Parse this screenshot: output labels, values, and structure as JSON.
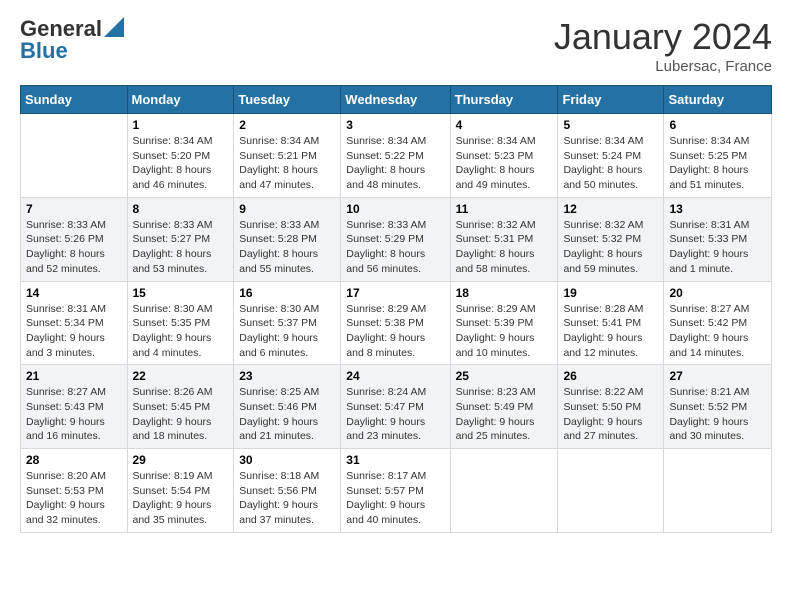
{
  "logo": {
    "general": "General",
    "blue": "Blue"
  },
  "title": "January 2024",
  "location": "Lubersac, France",
  "days_header": [
    "Sunday",
    "Monday",
    "Tuesday",
    "Wednesday",
    "Thursday",
    "Friday",
    "Saturday"
  ],
  "weeks": [
    [
      {
        "day": "",
        "info": ""
      },
      {
        "day": "1",
        "info": "Sunrise: 8:34 AM\nSunset: 5:20 PM\nDaylight: 8 hours\nand 46 minutes."
      },
      {
        "day": "2",
        "info": "Sunrise: 8:34 AM\nSunset: 5:21 PM\nDaylight: 8 hours\nand 47 minutes."
      },
      {
        "day": "3",
        "info": "Sunrise: 8:34 AM\nSunset: 5:22 PM\nDaylight: 8 hours\nand 48 minutes."
      },
      {
        "day": "4",
        "info": "Sunrise: 8:34 AM\nSunset: 5:23 PM\nDaylight: 8 hours\nand 49 minutes."
      },
      {
        "day": "5",
        "info": "Sunrise: 8:34 AM\nSunset: 5:24 PM\nDaylight: 8 hours\nand 50 minutes."
      },
      {
        "day": "6",
        "info": "Sunrise: 8:34 AM\nSunset: 5:25 PM\nDaylight: 8 hours\nand 51 minutes."
      }
    ],
    [
      {
        "day": "7",
        "info": "Sunrise: 8:33 AM\nSunset: 5:26 PM\nDaylight: 8 hours\nand 52 minutes."
      },
      {
        "day": "8",
        "info": "Sunrise: 8:33 AM\nSunset: 5:27 PM\nDaylight: 8 hours\nand 53 minutes."
      },
      {
        "day": "9",
        "info": "Sunrise: 8:33 AM\nSunset: 5:28 PM\nDaylight: 8 hours\nand 55 minutes."
      },
      {
        "day": "10",
        "info": "Sunrise: 8:33 AM\nSunset: 5:29 PM\nDaylight: 8 hours\nand 56 minutes."
      },
      {
        "day": "11",
        "info": "Sunrise: 8:32 AM\nSunset: 5:31 PM\nDaylight: 8 hours\nand 58 minutes."
      },
      {
        "day": "12",
        "info": "Sunrise: 8:32 AM\nSunset: 5:32 PM\nDaylight: 8 hours\nand 59 minutes."
      },
      {
        "day": "13",
        "info": "Sunrise: 8:31 AM\nSunset: 5:33 PM\nDaylight: 9 hours\nand 1 minute."
      }
    ],
    [
      {
        "day": "14",
        "info": "Sunrise: 8:31 AM\nSunset: 5:34 PM\nDaylight: 9 hours\nand 3 minutes."
      },
      {
        "day": "15",
        "info": "Sunrise: 8:30 AM\nSunset: 5:35 PM\nDaylight: 9 hours\nand 4 minutes."
      },
      {
        "day": "16",
        "info": "Sunrise: 8:30 AM\nSunset: 5:37 PM\nDaylight: 9 hours\nand 6 minutes."
      },
      {
        "day": "17",
        "info": "Sunrise: 8:29 AM\nSunset: 5:38 PM\nDaylight: 9 hours\nand 8 minutes."
      },
      {
        "day": "18",
        "info": "Sunrise: 8:29 AM\nSunset: 5:39 PM\nDaylight: 9 hours\nand 10 minutes."
      },
      {
        "day": "19",
        "info": "Sunrise: 8:28 AM\nSunset: 5:41 PM\nDaylight: 9 hours\nand 12 minutes."
      },
      {
        "day": "20",
        "info": "Sunrise: 8:27 AM\nSunset: 5:42 PM\nDaylight: 9 hours\nand 14 minutes."
      }
    ],
    [
      {
        "day": "21",
        "info": "Sunrise: 8:27 AM\nSunset: 5:43 PM\nDaylight: 9 hours\nand 16 minutes."
      },
      {
        "day": "22",
        "info": "Sunrise: 8:26 AM\nSunset: 5:45 PM\nDaylight: 9 hours\nand 18 minutes."
      },
      {
        "day": "23",
        "info": "Sunrise: 8:25 AM\nSunset: 5:46 PM\nDaylight: 9 hours\nand 21 minutes."
      },
      {
        "day": "24",
        "info": "Sunrise: 8:24 AM\nSunset: 5:47 PM\nDaylight: 9 hours\nand 23 minutes."
      },
      {
        "day": "25",
        "info": "Sunrise: 8:23 AM\nSunset: 5:49 PM\nDaylight: 9 hours\nand 25 minutes."
      },
      {
        "day": "26",
        "info": "Sunrise: 8:22 AM\nSunset: 5:50 PM\nDaylight: 9 hours\nand 27 minutes."
      },
      {
        "day": "27",
        "info": "Sunrise: 8:21 AM\nSunset: 5:52 PM\nDaylight: 9 hours\nand 30 minutes."
      }
    ],
    [
      {
        "day": "28",
        "info": "Sunrise: 8:20 AM\nSunset: 5:53 PM\nDaylight: 9 hours\nand 32 minutes."
      },
      {
        "day": "29",
        "info": "Sunrise: 8:19 AM\nSunset: 5:54 PM\nDaylight: 9 hours\nand 35 minutes."
      },
      {
        "day": "30",
        "info": "Sunrise: 8:18 AM\nSunset: 5:56 PM\nDaylight: 9 hours\nand 37 minutes."
      },
      {
        "day": "31",
        "info": "Sunrise: 8:17 AM\nSunset: 5:57 PM\nDaylight: 9 hours\nand 40 minutes."
      },
      {
        "day": "",
        "info": ""
      },
      {
        "day": "",
        "info": ""
      },
      {
        "day": "",
        "info": ""
      }
    ]
  ]
}
